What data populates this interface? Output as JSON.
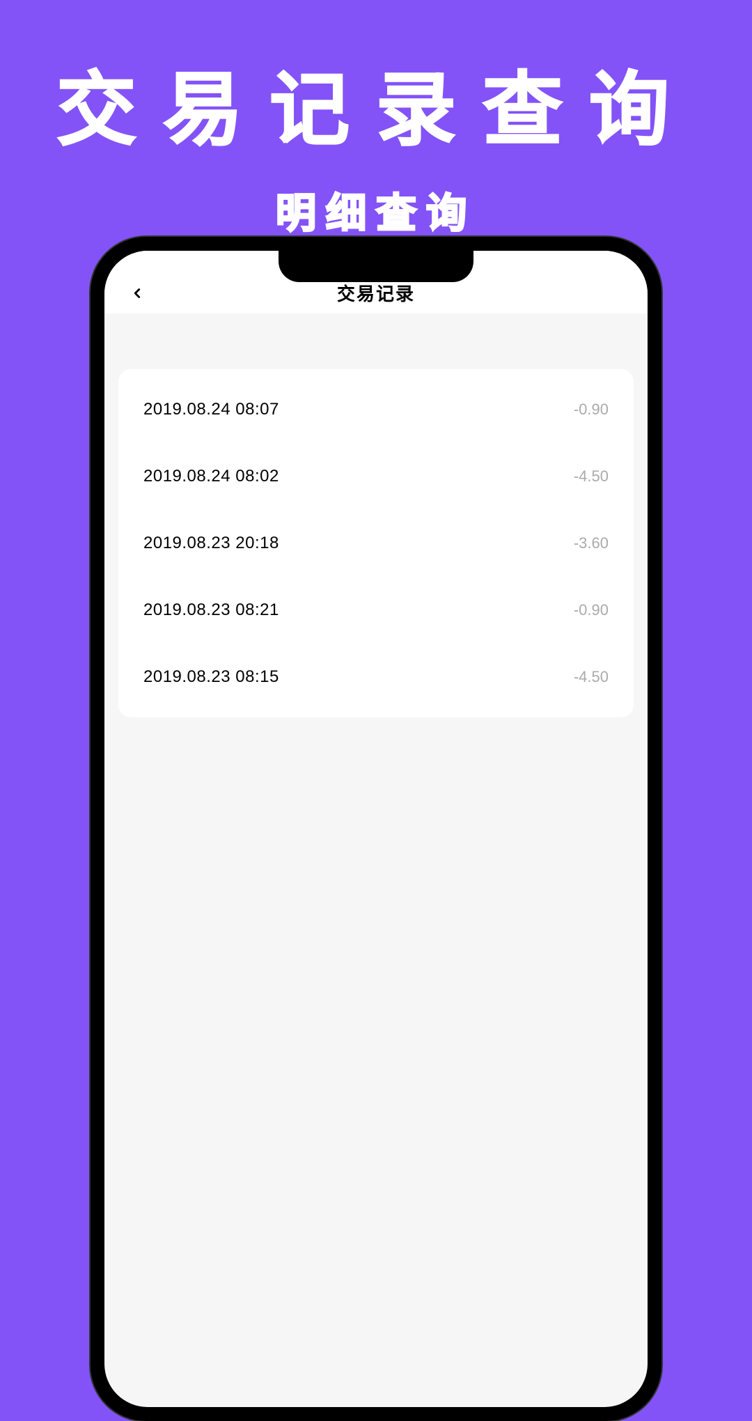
{
  "hero": {
    "title": "交易记录查询",
    "subtitle": "明细查询"
  },
  "app": {
    "header_title": "交易记录"
  },
  "records": [
    {
      "time": "2019.08.24 08:07",
      "amount": "-0.90"
    },
    {
      "time": "2019.08.24 08:02",
      "amount": "-4.50"
    },
    {
      "time": "2019.08.23 20:18",
      "amount": "-3.60"
    },
    {
      "time": "2019.08.23 08:21",
      "amount": "-0.90"
    },
    {
      "time": "2019.08.23 08:15",
      "amount": "-4.50"
    }
  ]
}
